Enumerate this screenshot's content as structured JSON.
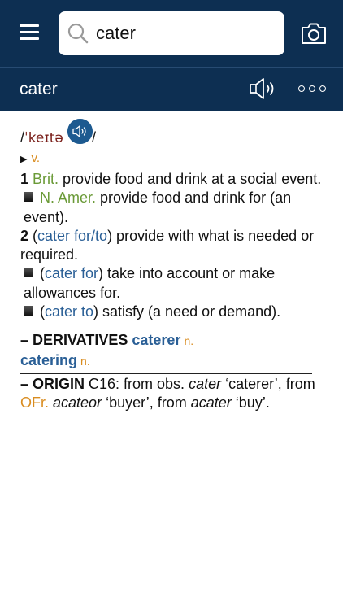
{
  "header": {
    "search": {
      "value": "cater",
      "icon": "search-icon"
    },
    "menu_icon": "menu-icon",
    "camera_icon": "camera-icon",
    "word_title": "cater",
    "speaker_icon": "speaker-icon",
    "more_icon": "more-icon",
    "background_color": "#0d2f52"
  },
  "entry": {
    "pron_open": "/",
    "pron": "ˈkeɪtə",
    "pron_close": "/",
    "pos_arrow": "▶",
    "pos": "v.",
    "senses": [
      {
        "num": "1",
        "label": "Brit.",
        "text": " provide food and drink at a social event."
      },
      {
        "label": "N. Amer.",
        "text": " provide food and drink for (an event)."
      },
      {
        "num": "2",
        "open": " (",
        "xref": "cater for/to",
        "text": ") provide with what is needed or required."
      },
      {
        "open": "(",
        "xref": "cater for",
        "text": ") take into account or make allowances for."
      },
      {
        "open": "(",
        "xref": "cater to",
        "text": ") satisfy (a need or demand)."
      }
    ],
    "derivatives": {
      "heading": "– DERIVATIVES",
      "items": [
        {
          "word": "caterer",
          "pos": "n."
        },
        {
          "word": "catering",
          "pos": "n."
        }
      ]
    },
    "origin": {
      "heading": "– ORIGIN",
      "t1": " C16: from obs. ",
      "i1": "cater",
      "t2": " ‘caterer’, from ",
      "lang": "OFr.",
      "t3": " ",
      "i2": "acateor",
      "t4": " ‘buyer’, from ",
      "i3": "acater",
      "t5": " ‘buy’."
    }
  },
  "colors": {
    "label_green": "#6a9a37",
    "xref_blue": "#2a5f96",
    "pos_orange": "#d98c1f",
    "pron_red": "#7a1f1a"
  }
}
